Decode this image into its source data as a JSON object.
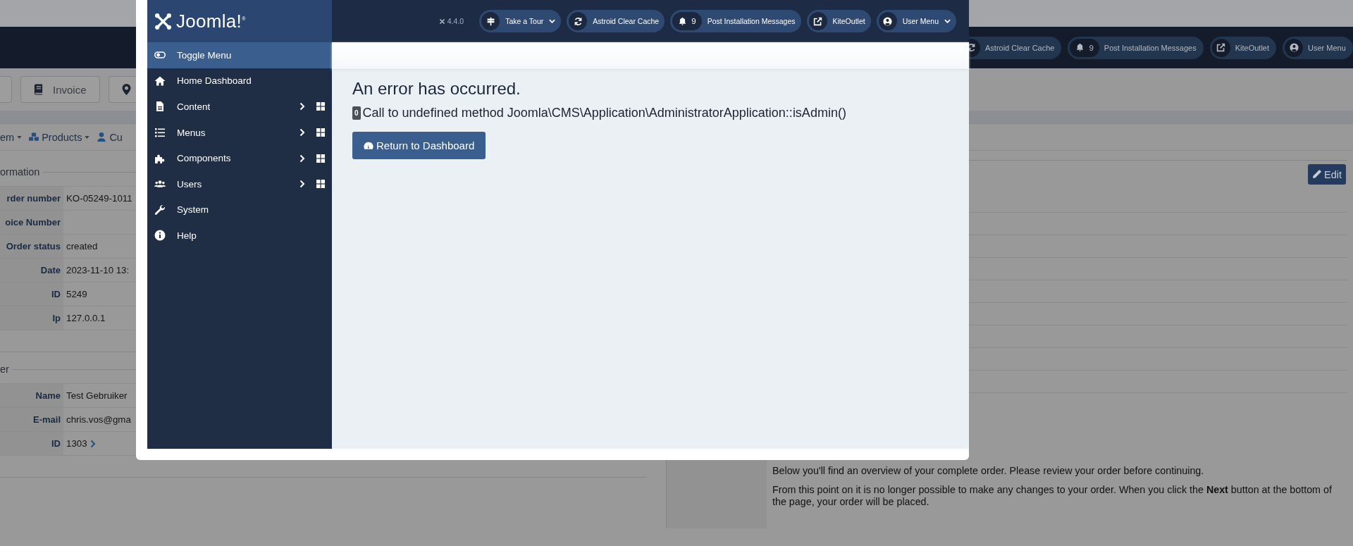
{
  "background_page": {
    "header_buttons": [
      {
        "label": "Astroid Clear Cache"
      },
      {
        "label": "Post Installation Messages",
        "count": "9"
      },
      {
        "label": "KiteOutlet"
      },
      {
        "label": "User Menu"
      }
    ],
    "toolbar_buttons": [
      "Invoice"
    ],
    "nav_menu": [
      {
        "label": "em",
        "dropdown": true
      },
      {
        "label": "Products",
        "dropdown": true
      },
      {
        "label": "Cu",
        "dropdown": false
      }
    ],
    "order_information": {
      "legend": "ormation",
      "rows": [
        {
          "label": "rder number",
          "value": "KO-05249-1011"
        },
        {
          "label": "oice Number"
        },
        {
          "label": "Order status",
          "value": "created"
        },
        {
          "label": "Date",
          "value": "2023-11-10 13:"
        },
        {
          "label": "ID",
          "value": "5249"
        },
        {
          "label": "Ip",
          "value": "127.0.0.1"
        }
      ]
    },
    "customer": {
      "legend": "er",
      "rows": [
        {
          "label": "Name",
          "value": "Test Gebruiker",
          "link": false
        },
        {
          "label": "E-mail",
          "value": "chris.vos@gma",
          "link": false
        },
        {
          "label": "ID",
          "value": "1303",
          "link": true
        }
      ]
    },
    "edit_button": "Edit",
    "intro": [
      "Below you'll find an overview of your complete order. Please review your order before continuing.",
      "From this point on it is no longer possible to make any changes to your order. When you click the **Next** button at the bottom of the page, your order will be placed."
    ]
  },
  "modal": {
    "brand": "Joomla!$^{®}$",
    "version": "4.4.0",
    "header_buttons": [
      {
        "label": "Take a Tour",
        "dropdown": true
      },
      {
        "label": "Astroid Clear Cache",
        "dropdown": false
      },
      {
        "label": "Post Installation Messages",
        "count": "9",
        "dropdown": false
      },
      {
        "label": "KiteOutlet",
        "dropdown": false
      },
      {
        "label": "User Menu",
        "dropdown": true
      }
    ],
    "sidebar": {
      "items": [
        {
          "label": "Toggle Menu",
          "selected": true,
          "submenu": false
        },
        {
          "label": "Home Dashboard",
          "selected": false,
          "submenu": false
        },
        {
          "label": "Content",
          "selected": false,
          "submenu": true
        },
        {
          "label": "Menus",
          "selected": false,
          "submenu": true
        },
        {
          "label": "Components",
          "selected": false,
          "submenu": true
        },
        {
          "label": "Users",
          "selected": false,
          "submenu": true
        },
        {
          "label": "System",
          "selected": false,
          "submenu": false
        },
        {
          "label": "Help",
          "selected": false,
          "submenu": false
        }
      ]
    },
    "error": {
      "title": "An error has occurred.",
      "code": "0",
      "message": "Call to undefined method Joomla\\CMS\\Application\\AdministratorApplication::isAdmin()",
      "button": "Return to Dashboard"
    }
  }
}
